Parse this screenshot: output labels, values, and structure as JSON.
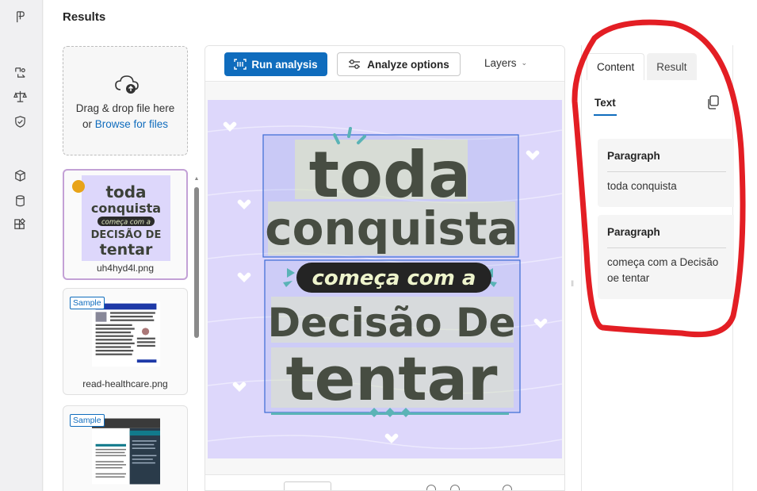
{
  "rail": {
    "icons": [
      "app-logo-icon",
      "convert-icon",
      "scale-icon",
      "shield-check-icon",
      "cube-icon",
      "database-icon",
      "add-app-icon"
    ]
  },
  "header": {
    "title": "Results"
  },
  "dropzone": {
    "line1": "Drag & drop file here",
    "or": "or",
    "browse": "Browse for files"
  },
  "files": [
    {
      "name": "uh4hyd4l.png",
      "selected": true,
      "badge": ""
    },
    {
      "name": "read-healthcare.png",
      "selected": false,
      "badge": "Sample"
    },
    {
      "name": "",
      "selected": false,
      "badge": "Sample"
    }
  ],
  "toolbar": {
    "run_label": "Run analysis",
    "options_label": "Analyze options",
    "layers_label": "Layers"
  },
  "poster": {
    "line1": "toda",
    "line2": "conquista",
    "line3": "começa com a",
    "line4": "Decisão De",
    "line5": "tentar"
  },
  "panel": {
    "tabs": [
      {
        "label": "Content",
        "active": true
      },
      {
        "label": "Result",
        "active": false
      }
    ],
    "subtab": "Text",
    "paragraphs": [
      {
        "heading": "Paragraph",
        "text": "toda conquista"
      },
      {
        "heading": "Paragraph",
        "text": "começa com a Decisão oe tentar"
      }
    ]
  },
  "colors": {
    "accent": "#0f6cbd",
    "poster_bg": "#ddd7fb",
    "poster_text": "#4a4f44",
    "highlight": "#e53935",
    "teal": "#5ab3b6"
  }
}
